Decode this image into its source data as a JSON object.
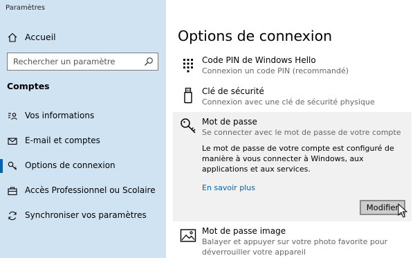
{
  "window": {
    "title": "Paramètres"
  },
  "sidebar": {
    "home": {
      "label": "Accueil",
      "icon": "home-icon"
    },
    "search": {
      "placeholder": "Rechercher un paramètre",
      "icon": "search-icon"
    },
    "section_title": "Comptes",
    "items": [
      {
        "label": "Vos informations",
        "icon": "person-card-icon",
        "selected": false
      },
      {
        "label": "E-mail et comptes",
        "icon": "mail-icon",
        "selected": false
      },
      {
        "label": "Options de connexion",
        "icon": "key-icon",
        "selected": true
      },
      {
        "label": "Accès Professionnel ou Scolaire",
        "icon": "briefcase-icon",
        "selected": false
      },
      {
        "label": "Synchroniser vos paramètres",
        "icon": "sync-icon",
        "selected": false
      }
    ],
    "accent_color": "#0063b1",
    "background_color": "#cfe3f3"
  },
  "main": {
    "title": "Options de connexion",
    "options": [
      {
        "title": "Code PIN de Windows Hello",
        "subtitle": "Connexion un code PIN (recommandé)",
        "icon": "keypad-icon"
      },
      {
        "title": "Clé de sécurité",
        "subtitle": "Connexion avec une clé de sécurité physique",
        "icon": "usb-key-icon"
      },
      {
        "title": "Mot de passe",
        "subtitle": "Se connecter avec le mot de passe de votre compte",
        "icon": "key-icon",
        "expanded": true,
        "description": "Le mot de passe de votre compte est configuré de manière à vous connecter à Windows, aux applications et aux services.",
        "link": "En savoir plus",
        "button": "Modifier"
      },
      {
        "title": "Mot de passe image",
        "subtitle_lines": [
          "Balayer et appuyer sur votre photo favorite pour",
          "déverrouiller votre appareil"
        ],
        "icon": "picture-icon"
      }
    ],
    "link_color": "#0063b1"
  }
}
